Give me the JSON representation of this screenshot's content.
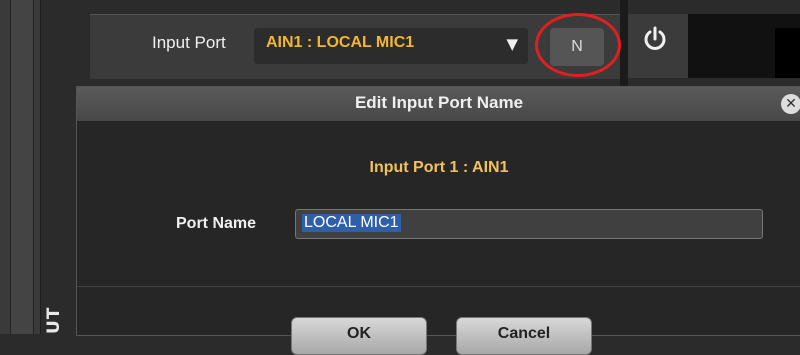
{
  "top": {
    "input_port_label": "Input Port",
    "selected_port": "AIN1 : LOCAL MIC1",
    "dropdown_arrow": "▼",
    "n_button_label": "N",
    "highlight_color": "#e02020",
    "accent_color": "#f2b632"
  },
  "side": {
    "vertical_text": "UT"
  },
  "dialog": {
    "title": "Edit Input Port Name",
    "close_glyph": "✕",
    "subtitle": "Input Port 1 : AIN1",
    "port_name_label": "Port Name",
    "port_name_value": "LOCAL MIC1",
    "ok_label": "OK",
    "cancel_label": "Cancel"
  },
  "icons": [
    "power-icon",
    "close-icon",
    "chevron-down-icon"
  ]
}
